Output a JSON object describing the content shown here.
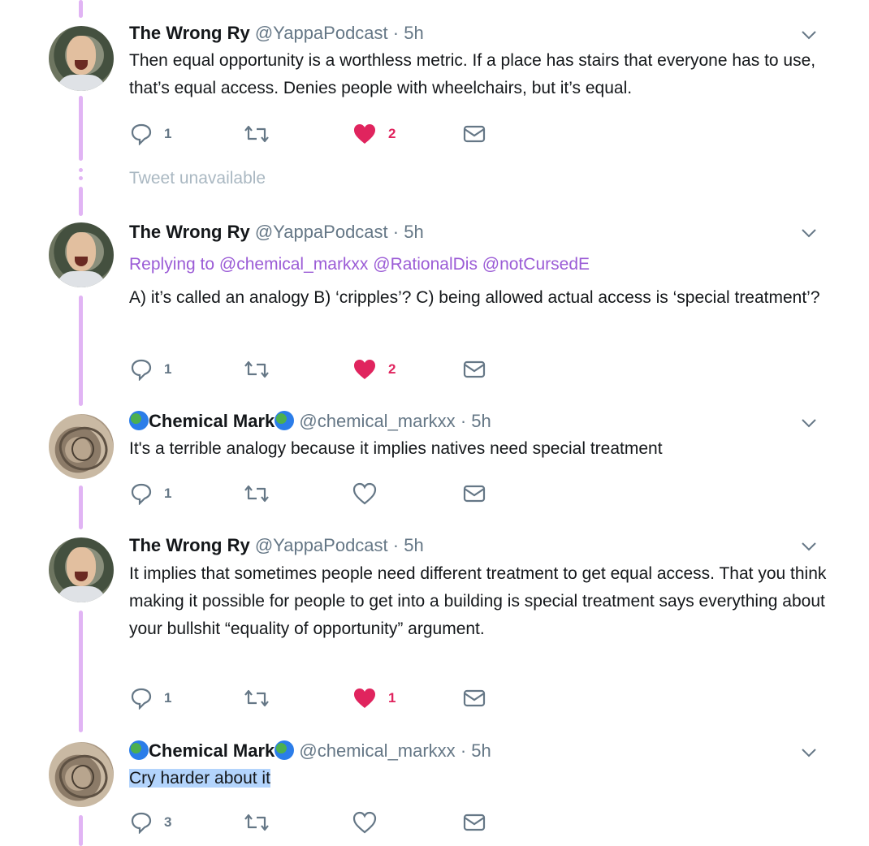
{
  "colors": {
    "thread_line": "#e1b4f4",
    "link": "#9b5cd6",
    "like": "#e0245e",
    "muted": "#657786",
    "unavailable": "#aab8c2",
    "selection": "#b3d4fc"
  },
  "tweets": [
    {
      "name": "The Wrong Ry",
      "handle": "@YappaPodcast",
      "time": "· 5h",
      "text": "Then equal opportunity is a worthless metric. If a place has stairs that everyone has to use, that’s equal access. Denies people with wheelchairs, but it’s equal.",
      "replies": "1",
      "retweets": "",
      "likes": "2",
      "liked": true
    },
    {
      "name": "The Wrong Ry",
      "handle": "@YappaPodcast",
      "time": "· 5h",
      "replying_prefix": "Replying to",
      "replying_to": "@chemical_markxx @RationalDis @notCursedE",
      "text": "A) it’s called an analogy B) ‘cripples’? C) being allowed actual access is ‘special treatment’?",
      "replies": "1",
      "retweets": "",
      "likes": "2",
      "liked": true
    },
    {
      "name": "Chemical Mark",
      "handle": "@chemical_markxx",
      "time": "· 5h",
      "text": "It's a terrible analogy because it implies natives need special treatment",
      "replies": "1",
      "retweets": "",
      "likes": "",
      "liked": false
    },
    {
      "name": "The Wrong Ry",
      "handle": "@YappaPodcast",
      "time": "· 5h",
      "text": "It implies that sometimes people need different treatment to get equal access. That you think making it possible for people to get into a building is special treatment says everything about your bullshit “equality of opportunity” argument.",
      "replies": "1",
      "retweets": "",
      "likes": "1",
      "liked": true
    },
    {
      "name": "Chemical Mark",
      "handle": "@chemical_markxx",
      "time": "· 5h",
      "text": "Cry harder about it",
      "replies": "3",
      "retweets": "",
      "likes": "",
      "liked": false
    }
  ],
  "unavailable_text": "Tweet unavailable",
  "icons": [
    "reply-icon",
    "retweet-icon",
    "heart-icon",
    "message-icon",
    "chevron-down-icon",
    "globe-emoji-icon"
  ]
}
